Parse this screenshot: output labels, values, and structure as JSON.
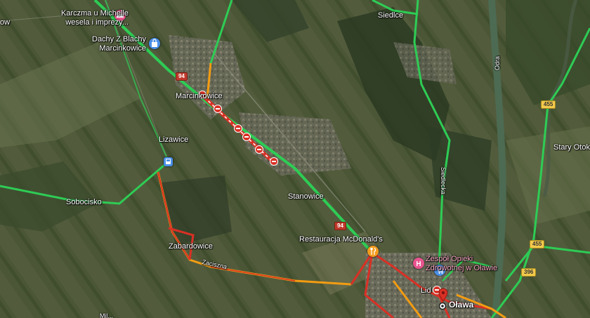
{
  "places": {
    "karczma": "Karczma u Michelle",
    "karczma_sub": "wesela i imprezy...",
    "dachy": "Dachy Z Blachy",
    "dachy_sub": "Marcinkowice",
    "siedlce": "Siedlce",
    "marcinkowice": "Marcinkowice",
    "lizawice": "Lizawice",
    "sobocisko": "Sobocisko",
    "stanowice": "Stanowice",
    "stary_otok": "Stary Otok",
    "zabardowice": "Zabardowice",
    "mcdonalds": "Restauracja McDonald's",
    "zespol": "Zespół Opieki",
    "zespol_sub": "Zdrowotnej w Oławie",
    "lidl": "Lid",
    "olawa": "Oława",
    "odra": "Odra",
    "siedlecka": "Siedlecka",
    "zaciszna": "Zaciszna",
    "edge_w": "ow",
    "edge_bl": "Mil..."
  },
  "shields": {
    "r94_top": "94",
    "r94_bottom": "94",
    "r455_top": "455",
    "r455_bottom": "455",
    "r396": "396"
  },
  "colors": {
    "traffic_fast": "#2ecc55",
    "traffic_slow": "#f39c12",
    "traffic_jam": "#d93025",
    "poi_pink": "#e8558f",
    "poi_blue": "#4a8fe7",
    "poi_orange": "#f29c1f"
  },
  "icons": {
    "karczma": "bed-icon",
    "dachy": "shopping-bag-icon",
    "mcdonalds": "fork-knife-icon",
    "hospital": "hospital-icon",
    "bus": "bus-icon",
    "lidl": "shopping-cart-icon",
    "olawa": "city-marker-icon",
    "closure": "road-closed-icon"
  }
}
